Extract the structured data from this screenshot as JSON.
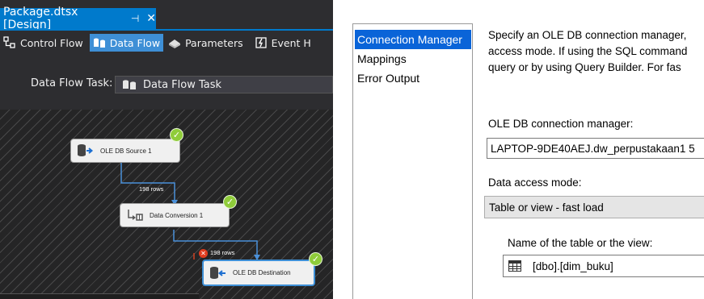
{
  "designer": {
    "doc_tab": {
      "title": "Package.dtsx [Design]",
      "pin": "⊣",
      "close": "✕"
    },
    "tabs": [
      {
        "label": "Control Flow",
        "active": false
      },
      {
        "label": "Data Flow",
        "active": true
      },
      {
        "label": "Parameters",
        "active": false
      },
      {
        "label": "Event H",
        "active": false
      }
    ],
    "task_label": "Data Flow Task:",
    "task_value": "Data Flow Task",
    "components": [
      {
        "label": "OLE DB Source 1",
        "status": "success"
      },
      {
        "label": "Data Conversion 1",
        "status": "success"
      },
      {
        "label": "OLE DB Destination",
        "status": "success",
        "selected": true
      }
    ],
    "paths": [
      {
        "rows": "198 rows",
        "error": false
      },
      {
        "rows": "198 rows",
        "error": true
      }
    ]
  },
  "editor": {
    "nav": [
      {
        "label": "Connection Manager",
        "selected": true
      },
      {
        "label": "Mappings",
        "selected": false
      },
      {
        "label": "Error Output",
        "selected": false
      }
    ],
    "description_lines": [
      "Specify an OLE DB connection manager,",
      "access mode. If using the SQL command",
      "query or by using Query Builder. For fas"
    ],
    "connection_label": "OLE DB connection manager:",
    "connection_value": "LAPTOP-9DE40AEJ.dw_perpustakaan1 5",
    "mode_label": "Data access mode:",
    "mode_value": "Table or view - fast load",
    "table_label": "Name of the table or the view:",
    "table_value": "[dbo].[dim_buku]"
  },
  "colors": {
    "accent": "#007acc",
    "selected_nav": "#0a64d8",
    "success": "#8fcc3a",
    "error": "#e03c1f",
    "path_line": "#4a90d9"
  }
}
